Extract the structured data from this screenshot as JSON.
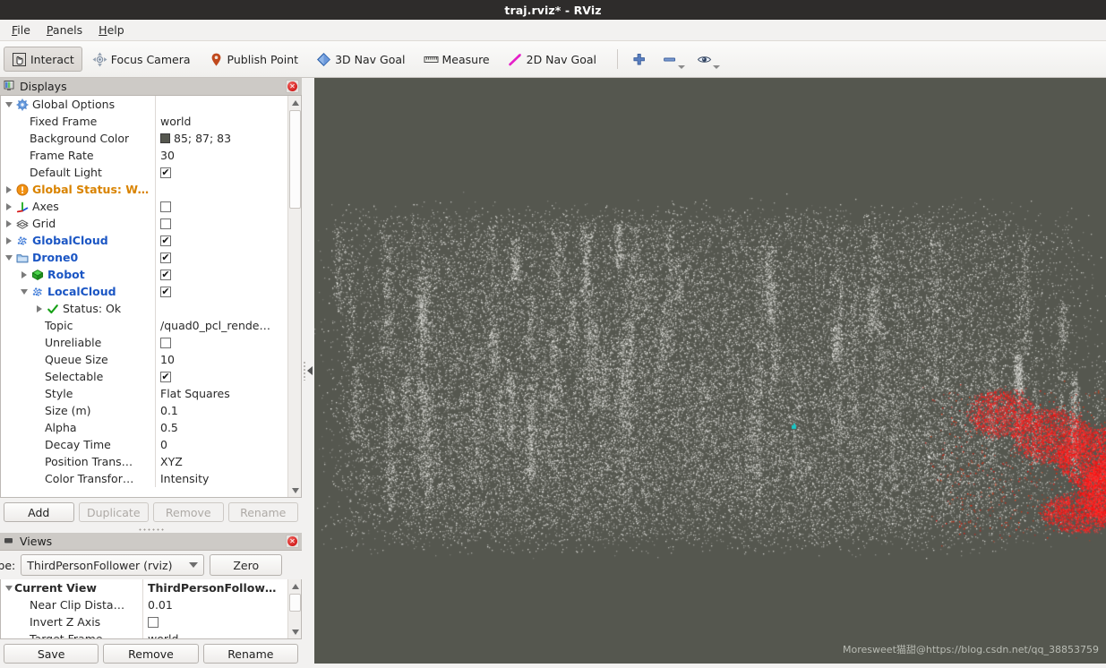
{
  "window": {
    "title": "traj.rviz* - RViz"
  },
  "menubar": {
    "items": [
      {
        "name": "file",
        "mnemonic": "F",
        "rest": "ile"
      },
      {
        "name": "panels",
        "mnemonic": "P",
        "rest": "anels"
      },
      {
        "name": "help",
        "mnemonic": "H",
        "rest": "elp"
      }
    ]
  },
  "toolbar": {
    "tools": [
      {
        "label": "Interact",
        "icon": "hand-cursor-icon",
        "checked": true
      },
      {
        "label": "Focus Camera",
        "icon": "focus-camera-icon",
        "checked": false
      },
      {
        "label": "Publish Point",
        "icon": "map-pin-icon",
        "checked": false
      },
      {
        "label": "3D Nav Goal",
        "icon": "blue-diamond-icon",
        "checked": false
      },
      {
        "label": "Measure",
        "icon": "ruler-icon",
        "checked": false
      },
      {
        "label": "2D Nav Goal",
        "icon": "magenta-arrow-icon",
        "checked": false
      }
    ],
    "actions": [
      {
        "name": "add-tool",
        "icon": "plus-icon",
        "dropdown": false
      },
      {
        "name": "remove-tool",
        "icon": "minus-icon",
        "dropdown": true
      },
      {
        "name": "visibility-tool",
        "icon": "eye-icon",
        "dropdown": true
      }
    ]
  },
  "displays": {
    "title": "Displays",
    "title_icon": "displays-panel-icon",
    "close_icon": "close-icon",
    "rows": [
      {
        "indent": 0,
        "expander": "down",
        "icon": "gear-icon",
        "label": "Global Options",
        "style": "plain",
        "value_type": "none"
      },
      {
        "indent": 1,
        "expander": "none",
        "icon": "none",
        "label": "Fixed Frame",
        "style": "plain",
        "value_type": "text",
        "value": "world"
      },
      {
        "indent": 1,
        "expander": "none",
        "icon": "none",
        "label": "Background Color",
        "style": "plain",
        "value_type": "color",
        "value": "85; 87; 83",
        "color": "#55574f"
      },
      {
        "indent": 1,
        "expander": "none",
        "icon": "none",
        "label": "Frame Rate",
        "style": "plain",
        "value_type": "text",
        "value": "30"
      },
      {
        "indent": 1,
        "expander": "none",
        "icon": "none",
        "label": "Default Light",
        "style": "plain",
        "value_type": "check",
        "checked": true
      },
      {
        "indent": 0,
        "expander": "right",
        "icon": "warning-icon",
        "label": "Global Status: Warn",
        "style": "warn",
        "value_type": "none"
      },
      {
        "indent": 0,
        "expander": "right",
        "icon": "axes-icon",
        "label": "Axes",
        "style": "plain",
        "value_type": "check",
        "checked": false
      },
      {
        "indent": 0,
        "expander": "right",
        "icon": "grid-icon",
        "label": "Grid",
        "style": "plain",
        "value_type": "check",
        "checked": false
      },
      {
        "indent": 0,
        "expander": "right",
        "icon": "pointcloud-icon",
        "label": "GlobalCloud",
        "style": "blue",
        "value_type": "check",
        "checked": true
      },
      {
        "indent": 0,
        "expander": "down",
        "icon": "folder-icon",
        "label": "Drone0",
        "style": "blue",
        "value_type": "check",
        "checked": true
      },
      {
        "indent": 1,
        "expander": "right",
        "icon": "green-cube-icon",
        "label": "Robot",
        "style": "blue",
        "value_type": "check",
        "checked": true
      },
      {
        "indent": 1,
        "expander": "down",
        "icon": "pointcloud-icon",
        "label": "LocalCloud",
        "style": "blue",
        "value_type": "check",
        "checked": true
      },
      {
        "indent": 2,
        "expander": "right",
        "icon": "checkmark-icon",
        "label": "Status: Ok",
        "style": "plain",
        "value_type": "none"
      },
      {
        "indent": 2,
        "expander": "none",
        "icon": "none",
        "label": "Topic",
        "style": "plain",
        "value_type": "text",
        "value": "/quad0_pcl_rende…"
      },
      {
        "indent": 2,
        "expander": "none",
        "icon": "none",
        "label": "Unreliable",
        "style": "plain",
        "value_type": "check",
        "checked": false
      },
      {
        "indent": 2,
        "expander": "none",
        "icon": "none",
        "label": "Queue Size",
        "style": "plain",
        "value_type": "text",
        "value": "10"
      },
      {
        "indent": 2,
        "expander": "none",
        "icon": "none",
        "label": "Selectable",
        "style": "plain",
        "value_type": "check",
        "checked": true
      },
      {
        "indent": 2,
        "expander": "none",
        "icon": "none",
        "label": "Style",
        "style": "plain",
        "value_type": "text",
        "value": "Flat Squares"
      },
      {
        "indent": 2,
        "expander": "none",
        "icon": "none",
        "label": "Size (m)",
        "style": "plain",
        "value_type": "text",
        "value": "0.1"
      },
      {
        "indent": 2,
        "expander": "none",
        "icon": "none",
        "label": "Alpha",
        "style": "plain",
        "value_type": "text",
        "value": "0.5"
      },
      {
        "indent": 2,
        "expander": "none",
        "icon": "none",
        "label": "Decay Time",
        "style": "plain",
        "value_type": "text",
        "value": "0"
      },
      {
        "indent": 2,
        "expander": "none",
        "icon": "none",
        "label": "Position Trans…",
        "style": "plain",
        "value_type": "text",
        "value": "XYZ"
      },
      {
        "indent": 2,
        "expander": "none",
        "icon": "none",
        "label": "Color Transfor…",
        "style": "plain",
        "value_type": "text",
        "value": "Intensity"
      }
    ],
    "buttons": [
      {
        "label": "Add",
        "enabled": true
      },
      {
        "label": "Duplicate",
        "enabled": false
      },
      {
        "label": "Remove",
        "enabled": false
      },
      {
        "label": "Rename",
        "enabled": false
      }
    ]
  },
  "views": {
    "title": "Views",
    "title_icon": "views-panel-icon",
    "close_icon": "close-icon",
    "type_label": "ype:",
    "type_value": "ThirdPersonFollower (rviz)",
    "zero_label": "Zero",
    "rows": [
      {
        "indent": 0,
        "expander": "down",
        "label": "Current View",
        "style": "bold",
        "value": "ThirdPersonFollow…",
        "value_style": "bold",
        "value_type": "text"
      },
      {
        "indent": 1,
        "expander": "none",
        "label": "Near Clip Dista…",
        "style": "plain",
        "value": "0.01",
        "value_style": "plain",
        "value_type": "text"
      },
      {
        "indent": 1,
        "expander": "none",
        "label": "Invert Z Axis",
        "style": "plain",
        "value": "",
        "value_style": "plain",
        "value_type": "check",
        "checked": false
      },
      {
        "indent": 1,
        "expander": "none",
        "label": "Target Frame",
        "style": "plain",
        "value": "world",
        "value_style": "plain",
        "value_type": "text"
      }
    ],
    "buttons": [
      {
        "label": "Save",
        "enabled": true
      },
      {
        "label": "Remove",
        "enabled": true
      },
      {
        "label": "Rename",
        "enabled": true
      }
    ]
  },
  "viewport": {
    "background_color": "#55574f",
    "watermark": "Moresweet猫甜@https://blog.csdn.net/qq_38853759",
    "cloud": {
      "point_color_primary": "#d2d2cc",
      "point_color_highlight": "#ff2a2a",
      "marker_color": "#19c6c6"
    }
  }
}
